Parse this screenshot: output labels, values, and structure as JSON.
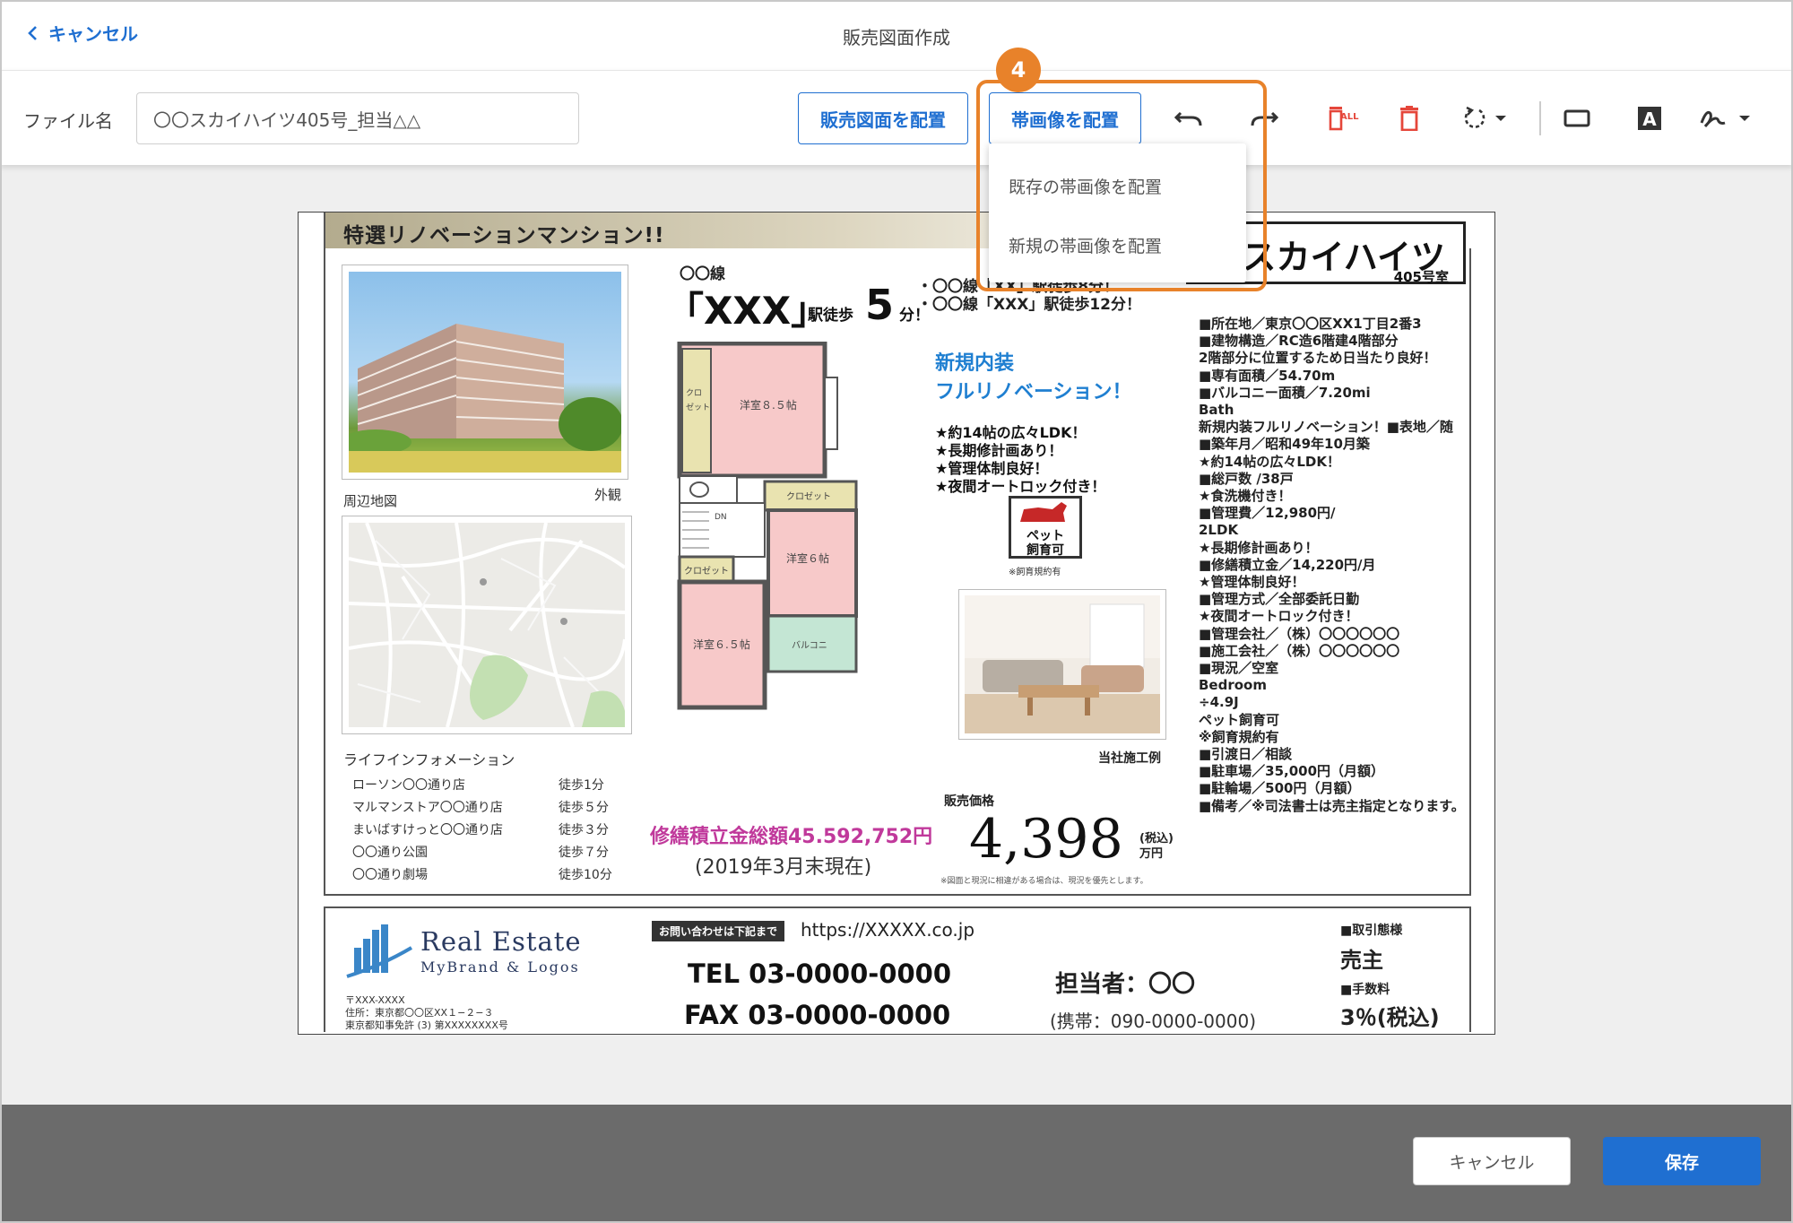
{
  "header": {
    "back_label": "キャンセル",
    "title": "販売図面作成"
  },
  "toolbar": {
    "file_label": "ファイル名",
    "file_value": "〇〇スカイハイツ405号_担当△△",
    "place_drawing": "販売図面を配置",
    "place_band": "帯画像を配置",
    "icons": [
      "undo-icon",
      "redo-icon",
      "delete-all-icon",
      "delete-icon",
      "rotate-icon",
      "rectangle-icon",
      "text-icon",
      "signature-icon"
    ],
    "delete_all_badge": "ALL"
  },
  "dropdown": {
    "items": [
      "既存の帯画像を配置",
      "新規の帯画像を配置"
    ]
  },
  "step_badge": "4",
  "colors": {
    "primary": "#1f6fd1",
    "highlight": "#e8822a",
    "danger": "#e5463a",
    "magenta": "#c0399b"
  },
  "document": {
    "band_title": "特選リノベーションマンション!!",
    "name": "スカイハイツ",
    "room": "405号室",
    "exterior_caption": "外観",
    "map_caption": "周辺地図",
    "life_title": "ライフインフォメーション",
    "life": [
      {
        "place": "ローソン〇〇通り店",
        "walk": "徒歩1分"
      },
      {
        "place": "マルマンストア〇〇通り店",
        "walk": "徒歩５分"
      },
      {
        "place": "まいばすけっと〇〇通り店",
        "walk": "徒歩３分"
      },
      {
        "place": "〇〇通り公園",
        "walk": "徒歩７分"
      },
      {
        "place": "〇〇通り劇場",
        "walk": "徒歩10分"
      }
    ],
    "line": "〇〇線",
    "station": "「XXX」",
    "walk_label": "駅徒歩",
    "walk_min": "5",
    "min_label": "分！",
    "routes": [
      "・〇〇線「XX」駅徒歩8分！",
      "・〇〇線「XXX」駅徒歩12分！"
    ],
    "reno_line1": "新規内装",
    "reno_line2": "フルリノベーション！",
    "features": [
      "★約14帖の広々LDK！",
      "★長期修計画あり！",
      "★管理体制良好！",
      "★夜間オートロック付き！"
    ],
    "pet_line1": "ペット",
    "pet_line2": "飼育可",
    "pet_note": "※飼育規約有",
    "room_caption": "当社施工例",
    "price_label": "販売価格",
    "price": "4,398",
    "tax": "(税込)",
    "price_unit": "万円",
    "price_note": "※図面と現況に相違がある場合は、現況を優先とします。",
    "repair_total": "修繕積立金総額45.592,752円",
    "repair_date": "(2019年3月末現在)",
    "floorplan": {
      "r1": "洋室８.５帖",
      "r2": "洋室６帖",
      "r3": "洋室６.５帖",
      "closet": "クロゼット",
      "closet2": "クロ",
      "closet3": "ゼット",
      "balcony": "バルコニ",
      "dn": "DN"
    },
    "info": [
      "■所在地／東京〇〇区XX1丁目2番3",
      "■建物構造／RC造6階建4階部分",
      "2階部分に位置するため日当たり良好！",
      "■専有面積／54.70m",
      "■バルコニー面積／7.20mi",
      "Bath",
      "新規内装フルリノベーション！■表地／随",
      "■築年月／昭和49年10月築",
      "★約14帖の広々LDK！",
      "■総戸数 /38戸",
      "★食洗機付き！",
      "■管理費／12,980円/",
      "2LDK",
      "★長期修計画あり！",
      "■修繕積立金／14,220円/月",
      "★管理体制良好！",
      "■管理方式／全部委託日勤",
      "★夜間オートロック付き！",
      "■管理会社／（株）〇〇〇〇〇〇",
      "■施工会社／（株）〇〇〇〇〇〇",
      "■現況／空室",
      "Bedroom",
      "÷4.9J",
      "ペット飼育可",
      "※飼育規約有",
      "■引渡日／相談",
      "■駐車場／35,000円（月額）",
      "■駐輪場／500円（月額）",
      "■備考／※司法書士は売主指定となります。"
    ]
  },
  "footer": {
    "brand_line1": "Real Estate",
    "brand_line2": "MyBrand & Logos",
    "postal": "〒XXX-XXXX",
    "address": "住所：東京都〇〇区XX１−２−３",
    "license": "東京都知事免許 (3) 第XXXXXXXX号",
    "contact_tag": "お問い合わせは下記まで",
    "url": "https://XXXXX.co.jp",
    "tel": "TEL 03-0000-0000",
    "fax": "FAX 03-0000-0000",
    "staff": "担当者：〇〇",
    "mobile": "(携帯：090-0000-0000)",
    "trade_label": "■取引態様",
    "trade_value": "売主",
    "fee_label": "■手数料",
    "fee_value": "3％(税込)"
  },
  "bottom": {
    "cancel": "キャンセル",
    "save": "保存"
  }
}
